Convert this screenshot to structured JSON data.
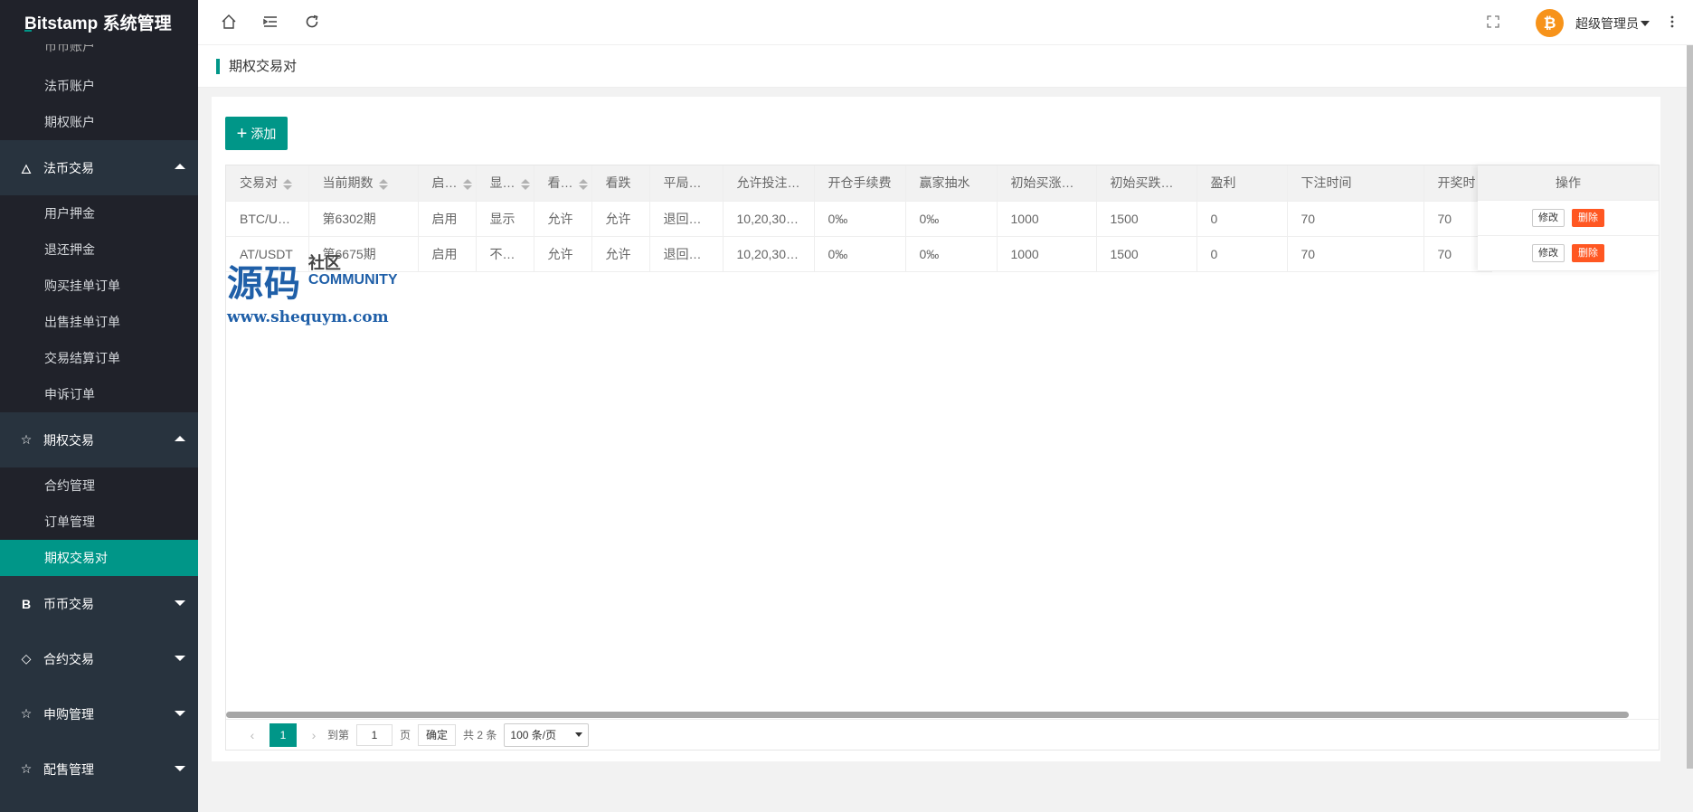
{
  "app": {
    "title": "Bitstamp 系统管理"
  },
  "sidebar": {
    "top_sub": [
      "币币账户",
      "法币账户",
      "期权账户"
    ],
    "groups": [
      {
        "label": "法币交易",
        "icon": "fire-icon",
        "expanded": true,
        "items": [
          "用户押金",
          "退还押金",
          "购买挂单订单",
          "出售挂单订单",
          "交易结算订单",
          "申诉订单"
        ]
      },
      {
        "label": "期权交易",
        "icon": "star-icon",
        "expanded": true,
        "items": [
          "合约管理",
          "订单管理",
          "期权交易对"
        ],
        "active_item": "期权交易对"
      },
      {
        "label": "币币交易",
        "icon": "bitcoin-b-icon",
        "expanded": false
      },
      {
        "label": "合约交易",
        "icon": "diamond-icon",
        "expanded": false
      },
      {
        "label": "申购管理",
        "icon": "star-icon",
        "expanded": false
      },
      {
        "label": "配售管理",
        "icon": "star-icon",
        "expanded": false
      }
    ]
  },
  "header": {
    "user_name": "超级管理员",
    "avatar_symbol": "₿",
    "icons": [
      "home-icon",
      "menu-fold-icon",
      "refresh-icon",
      "fullscreen-icon",
      "more-vertical-icon"
    ]
  },
  "tab": {
    "title": "期权交易对"
  },
  "toolbar": {
    "add_label": "添加"
  },
  "table": {
    "columns": [
      "交易对",
      "当前期数",
      "启…",
      "显…",
      "看…",
      "看跌",
      "平局…",
      "允许投注…",
      "开仓手续费",
      "赢家抽水",
      "初始买涨…",
      "初始买跌…",
      "盈利",
      "下注时间",
      "开奖时"
    ],
    "action_header": "操作",
    "rows": [
      [
        "BTC/U…",
        "第6302期",
        "启用",
        "显示",
        "允许",
        "允许",
        "退回…",
        "10,20,30…",
        "0‰",
        "0‰",
        "1000",
        "1500",
        "0",
        "70",
        "70"
      ],
      [
        "AT/USDT",
        "第6675期",
        "启用",
        "不…",
        "允许",
        "允许",
        "退回…",
        "10,20,30…",
        "0‰",
        "0‰",
        "1000",
        "1500",
        "0",
        "70",
        "70"
      ]
    ],
    "edit_label": "修改",
    "delete_label": "删除"
  },
  "pager": {
    "current_page": "1",
    "goto_label": "到第",
    "goto_value": "1",
    "page_unit": "页",
    "confirm_label": "确定",
    "total_text": "共 2 条",
    "page_size": "100 条/页"
  },
  "watermark": {
    "big": "源码",
    "cn": "社区",
    "en": "COMMUNITY",
    "url": "www.shequym.com"
  },
  "colors": {
    "accent": "#009688",
    "sidebar": "#28333e",
    "danger": "#ff5722",
    "avatar": "#f7931a"
  }
}
